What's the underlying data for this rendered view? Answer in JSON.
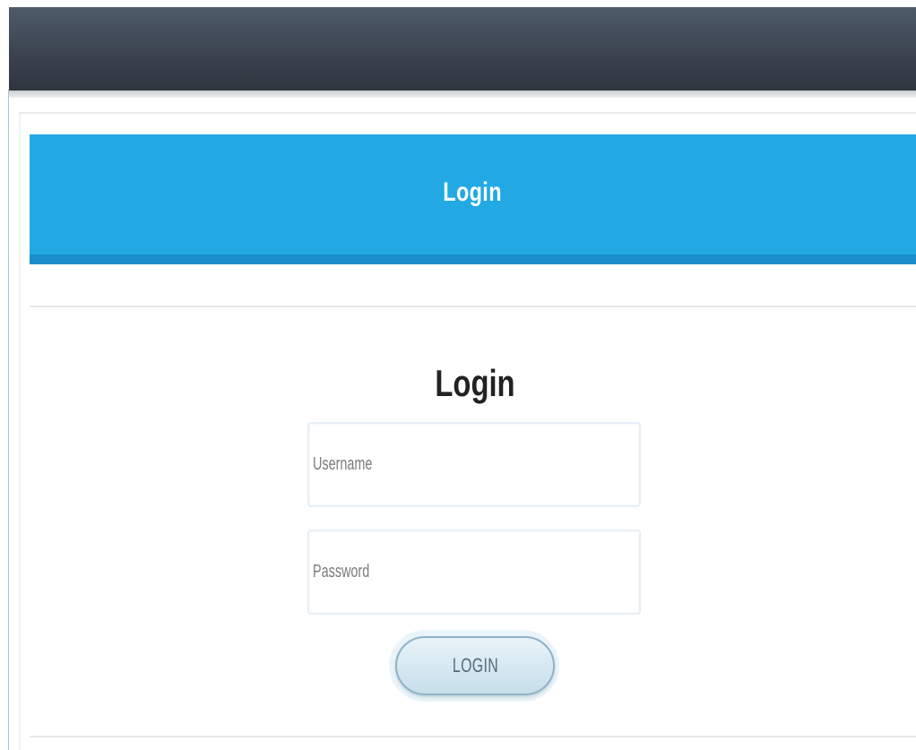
{
  "header": {
    "banner_title": "Login"
  },
  "form": {
    "title": "Login",
    "username_placeholder": "Username",
    "username_value": "",
    "password_placeholder": "Password",
    "password_value": "",
    "submit_label": "LOGIN"
  },
  "colors": {
    "topbar": "#3a424e",
    "banner": "#22a9e3",
    "banner_bottom": "#1a8ecb",
    "button_border": "#8fb3c7"
  }
}
